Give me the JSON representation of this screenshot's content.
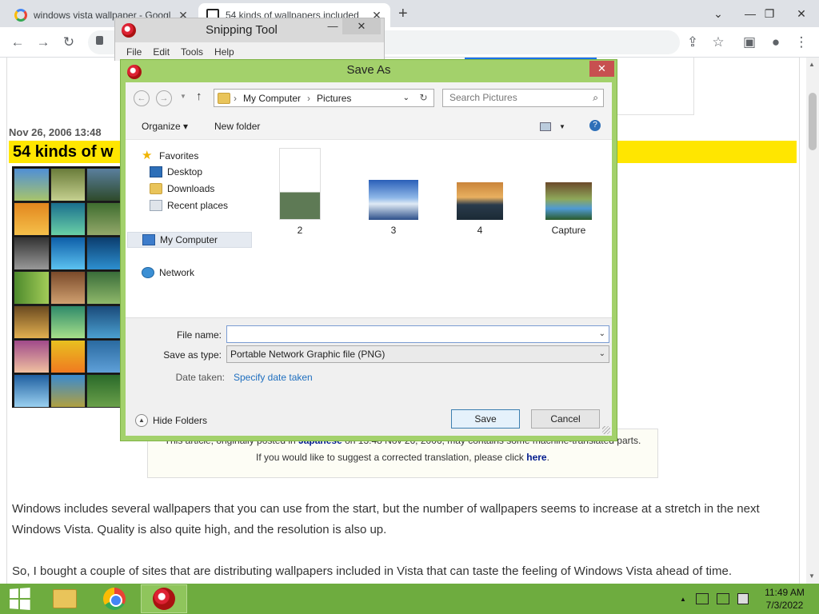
{
  "browser": {
    "tabs": [
      {
        "title": "windows vista wallpaper - Googl",
        "icon": "google-icon"
      },
      {
        "title": "54 kinds of wallpapers included",
        "icon": "gigazine-icon"
      }
    ],
    "new_tab": "+",
    "window_controls": {
      "collapse": "⌄",
      "minimize": "—",
      "restore": "❐",
      "close": "✕"
    }
  },
  "page": {
    "date": "Nov 26, 2006 13:48",
    "headline": "54 kinds of w",
    "note_line1_pre": "This article, originally posted in ",
    "note_line1_link": "Japanese",
    "note_line1_post": " on 13:48 Nov 26, 2006, may contains some machine-translated parts.",
    "note_line2_pre": "If you would like to suggest a corrected translation, please click ",
    "note_line2_link": "here",
    "note_line2_post": ".",
    "paragraph1": "Windows includes several wallpapers that you can use from the start, but the number of wallpapers seems to increase at a stretch in the next Windows Vista. Quality is also quite high, and the resolution is also up.",
    "paragraph2": "So, I bought a couple of sites that are distributing wallpapers included in Vista that can taste the feeling of Windows Vista ahead of time."
  },
  "snipping_tool": {
    "title": "Snipping Tool",
    "menu": [
      "File",
      "Edit",
      "Tools",
      "Help"
    ]
  },
  "dialog": {
    "title": "Save As",
    "close": "✕",
    "breadcrumb": [
      "My Computer",
      "Pictures"
    ],
    "search_placeholder": "Search Pictures",
    "organize": "Organize ▾",
    "new_folder": "New folder",
    "nav": {
      "favorites": "Favorites",
      "desktop": "Desktop",
      "downloads": "Downloads",
      "recent": "Recent places",
      "computer": "My Computer",
      "network": "Network"
    },
    "files": [
      {
        "name": "2",
        "colors": [
          "#ffffff",
          "#5e7a55"
        ]
      },
      {
        "name": "3",
        "colors": [
          "#2a5fb8",
          "#dfeaf5"
        ]
      },
      {
        "name": "4",
        "colors": [
          "#c9843a",
          "#2a3b4c"
        ]
      },
      {
        "name": "Capture",
        "colors": [
          "#6b4a2b",
          "#4f9ad3"
        ]
      }
    ],
    "file_name_label": "File name:",
    "file_name_value": "",
    "save_type_label": "Save as type:",
    "save_type_value": "Portable Network Graphic file (PNG)",
    "date_taken_label": "Date taken:",
    "date_taken_link": "Specify date taken",
    "hide_folders": "Hide Folders",
    "save": "Save",
    "cancel": "Cancel"
  },
  "taskbar": {
    "time": "11:49 AM",
    "date": "7/3/2022",
    "tray_arrow": "▲"
  },
  "colors": {
    "dialog_frame": "#a3d16b",
    "taskbar": "#6eac3f",
    "headline_bg": "#ffe600",
    "close_red": "#c75050"
  }
}
